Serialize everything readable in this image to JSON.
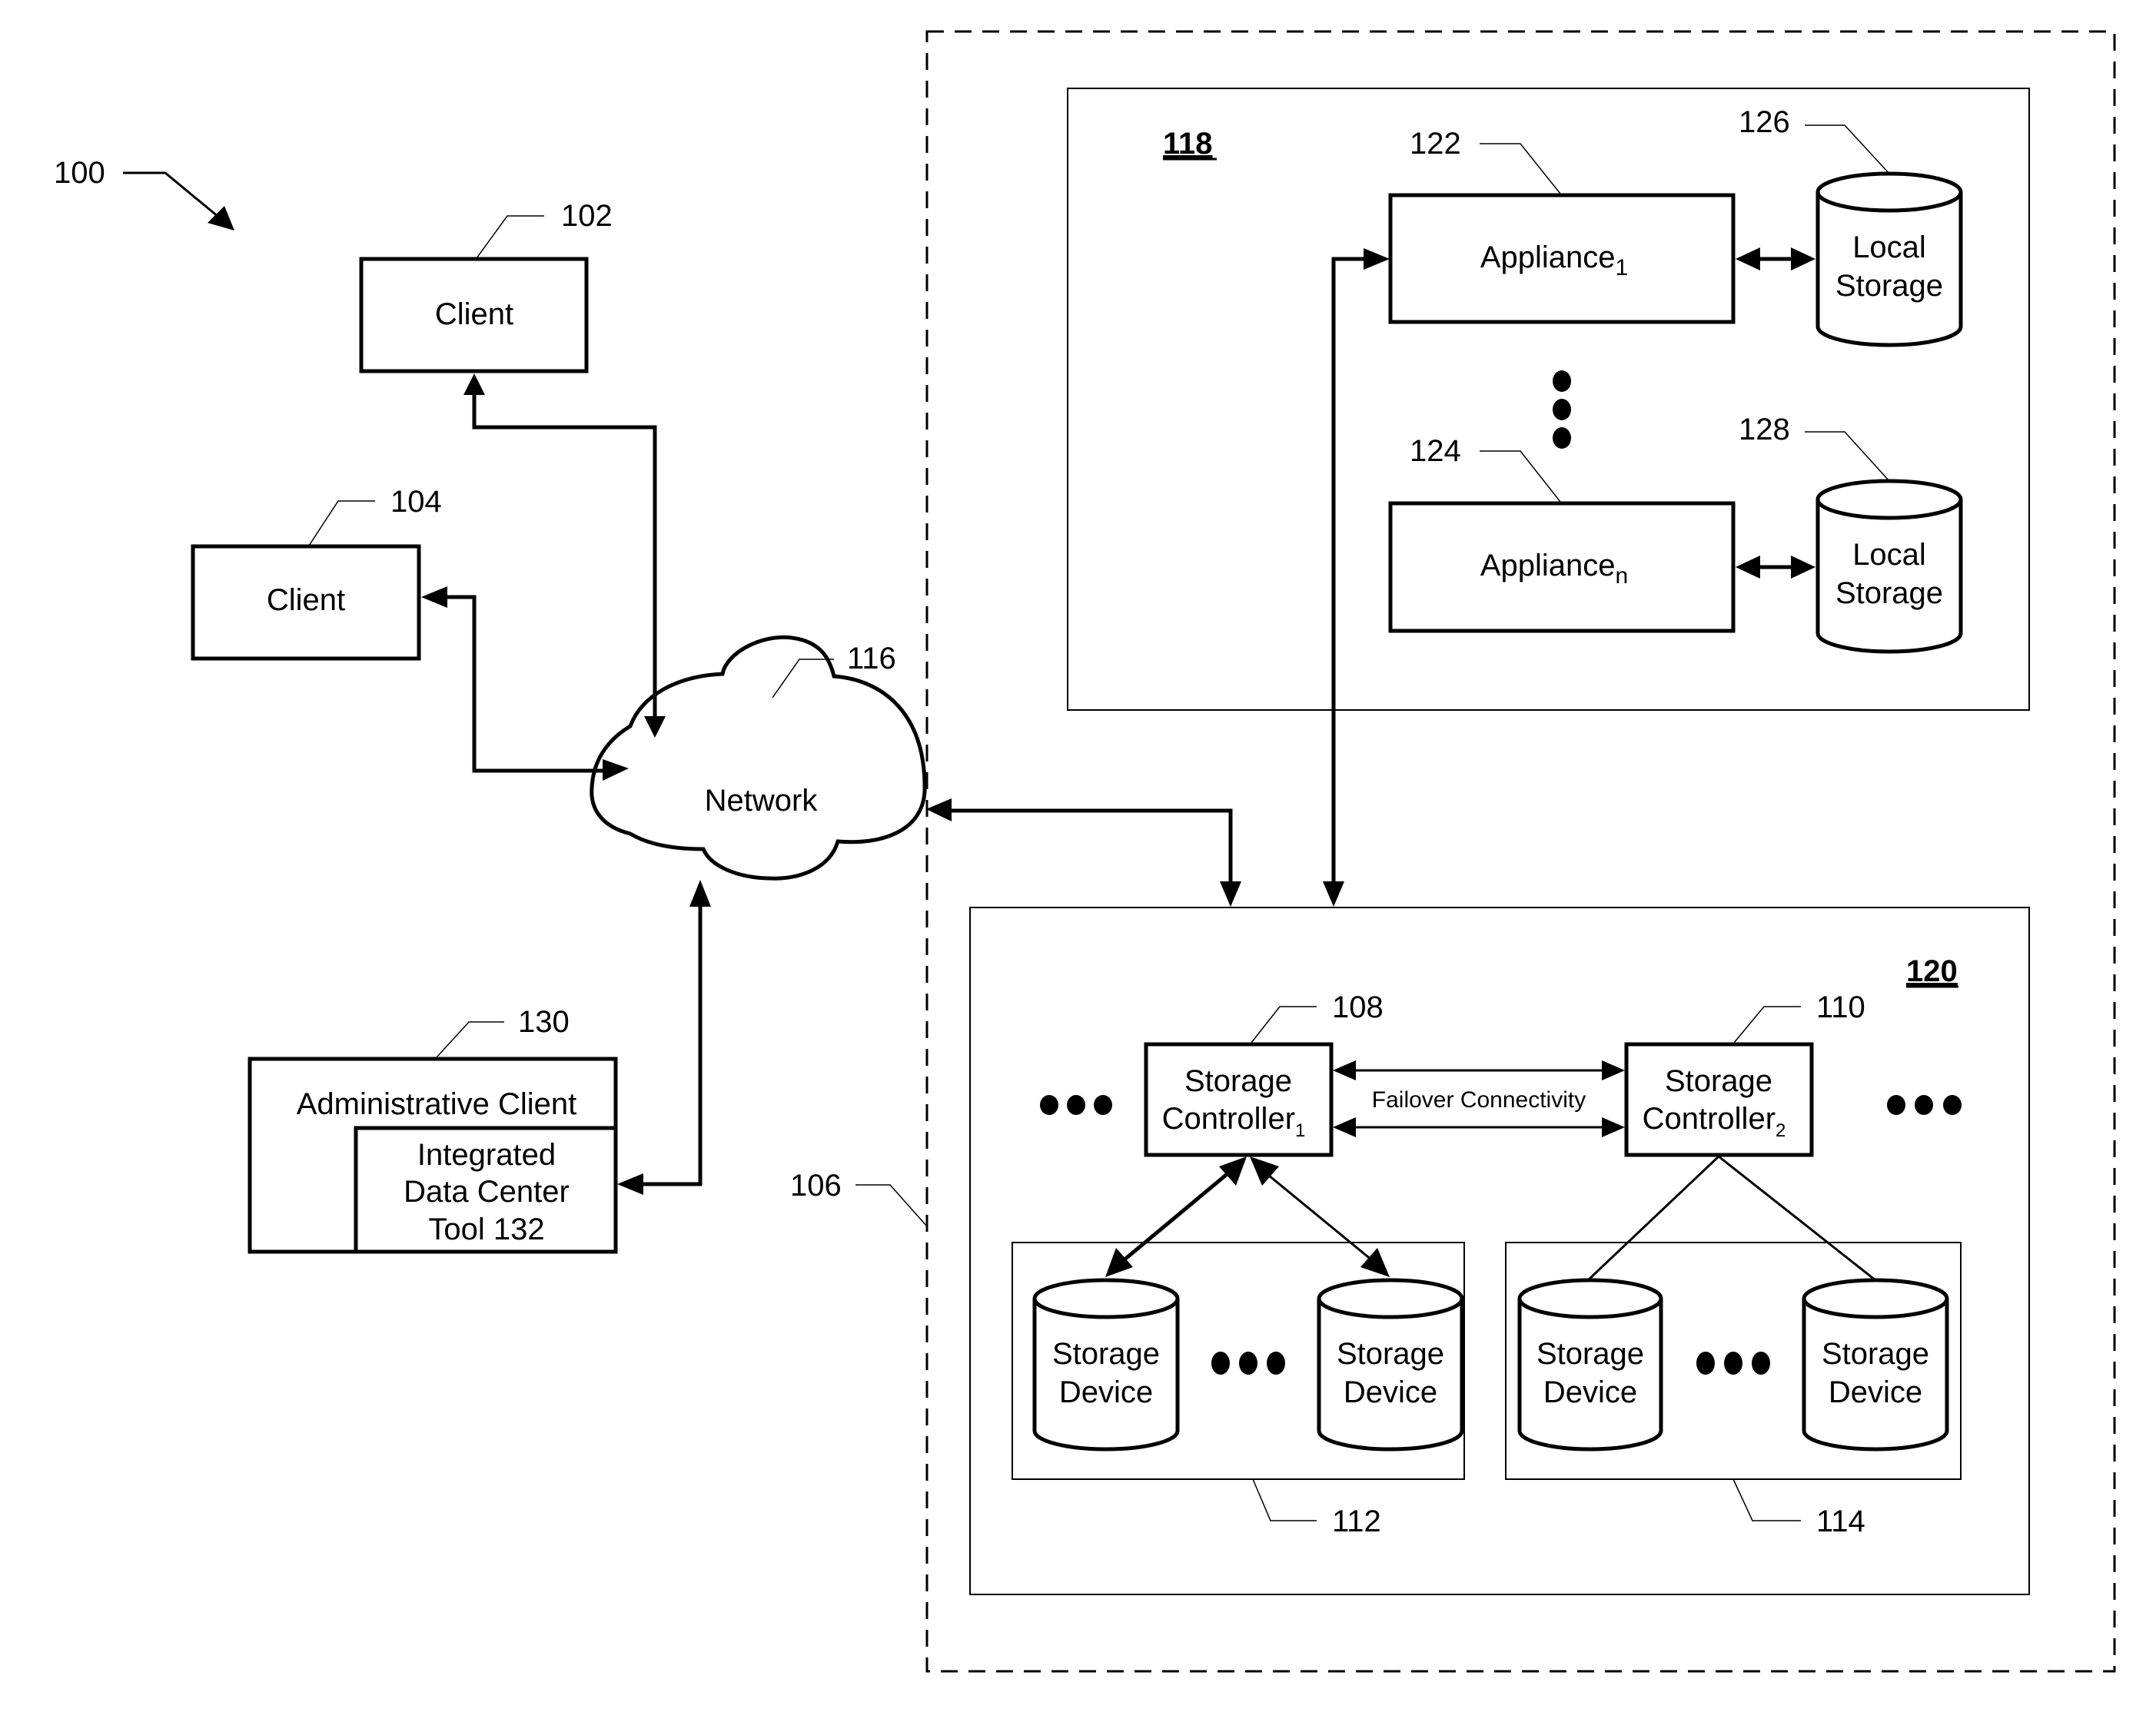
{
  "figure": {
    "ref": "100",
    "clients": [
      {
        "ref": "102",
        "label": "Client"
      },
      {
        "ref": "104",
        "label": "Client"
      }
    ],
    "network": {
      "ref": "116",
      "label": "Network"
    },
    "admin_client": {
      "ref": "130",
      "label": "Administrative Client",
      "tool_lines": [
        "Integrated",
        "Data Center",
        "Tool 132"
      ]
    },
    "data_center": {
      "ref": "106"
    },
    "appliance_group": {
      "ref": "118",
      "appliances": [
        {
          "ref": "122",
          "label": "Appliance",
          "subscript": "1",
          "storage_ref": "126",
          "storage_lines": [
            "Local",
            "Storage"
          ]
        },
        {
          "ref": "124",
          "label": "Appliance",
          "subscript": "n",
          "storage_ref": "128",
          "storage_lines": [
            "Local",
            "Storage"
          ]
        }
      ]
    },
    "storage_system": {
      "ref": "120",
      "controllers": [
        {
          "ref": "108",
          "line1": "Storage",
          "line2": "Controller",
          "subscript": "1"
        },
        {
          "ref": "110",
          "line1": "Storage",
          "line2": "Controller",
          "subscript": "2"
        }
      ],
      "failover_label": "Failover Connectivity",
      "device_groups": [
        {
          "ref": "112",
          "devices": [
            [
              "Storage",
              "Device"
            ],
            [
              "Storage",
              "Device"
            ]
          ]
        },
        {
          "ref": "114",
          "devices": [
            [
              "Storage",
              "Device"
            ],
            [
              "Storage",
              "Device"
            ]
          ]
        }
      ]
    }
  }
}
